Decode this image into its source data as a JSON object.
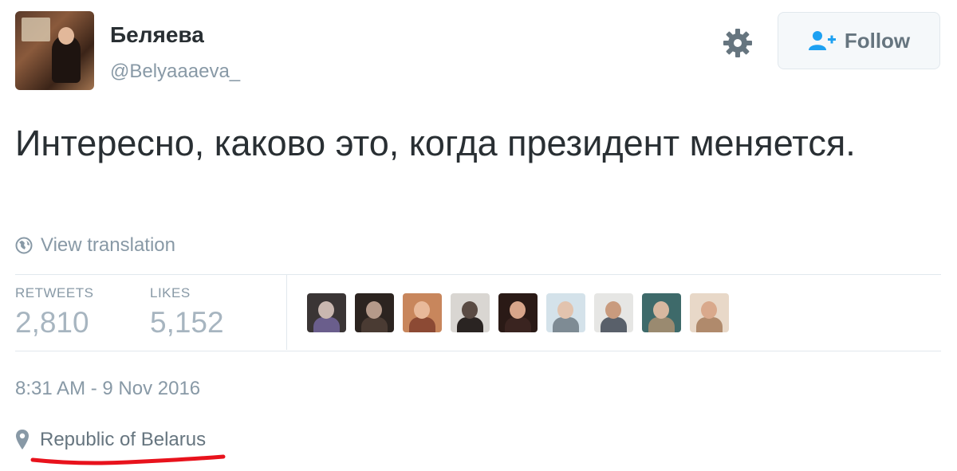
{
  "user": {
    "name": "Беляева",
    "handle": "@Belyaaaeva_"
  },
  "actions": {
    "follow_label": "Follow"
  },
  "tweet": {
    "text": "Интересно, каково это, когда президент меняется.",
    "view_translation": "View translation",
    "timestamp": "8:31 AM - 9 Nov 2016",
    "location": "Republic of Belarus"
  },
  "stats": {
    "retweets_label": "RETWEETS",
    "retweets_value": "2,810",
    "likes_label": "LIKES",
    "likes_value": "5,152"
  },
  "colors": {
    "annotation_underline": "#e8121c",
    "muted_text": "#8899a6",
    "divider": "#e1e8ed"
  },
  "likers": [
    {
      "bg": "#3a3535",
      "face": "#c9b7b0",
      "body": "#6a5e8c"
    },
    {
      "bg": "#2c2420",
      "face": "#b59a8a",
      "body": "#4a3b33"
    },
    {
      "bg": "#c8865c",
      "face": "#e8b99a",
      "body": "#8c4a34"
    },
    {
      "bg": "#d9d6d2",
      "face": "#5a4b44",
      "body": "#2a2422"
    },
    {
      "bg": "#2a1a16",
      "face": "#d7a58a",
      "body": "#3a2420"
    },
    {
      "bg": "#d4e2ea",
      "face": "#e2c3ae",
      "body": "#7e8b94"
    },
    {
      "bg": "#e6e6e4",
      "face": "#c99b7e",
      "body": "#59606a"
    },
    {
      "bg": "#3e6a6a",
      "face": "#d8b8a0",
      "body": "#9a8a70"
    },
    {
      "bg": "#e8d8c8",
      "face": "#d9a98c",
      "body": "#b08a6c"
    }
  ]
}
